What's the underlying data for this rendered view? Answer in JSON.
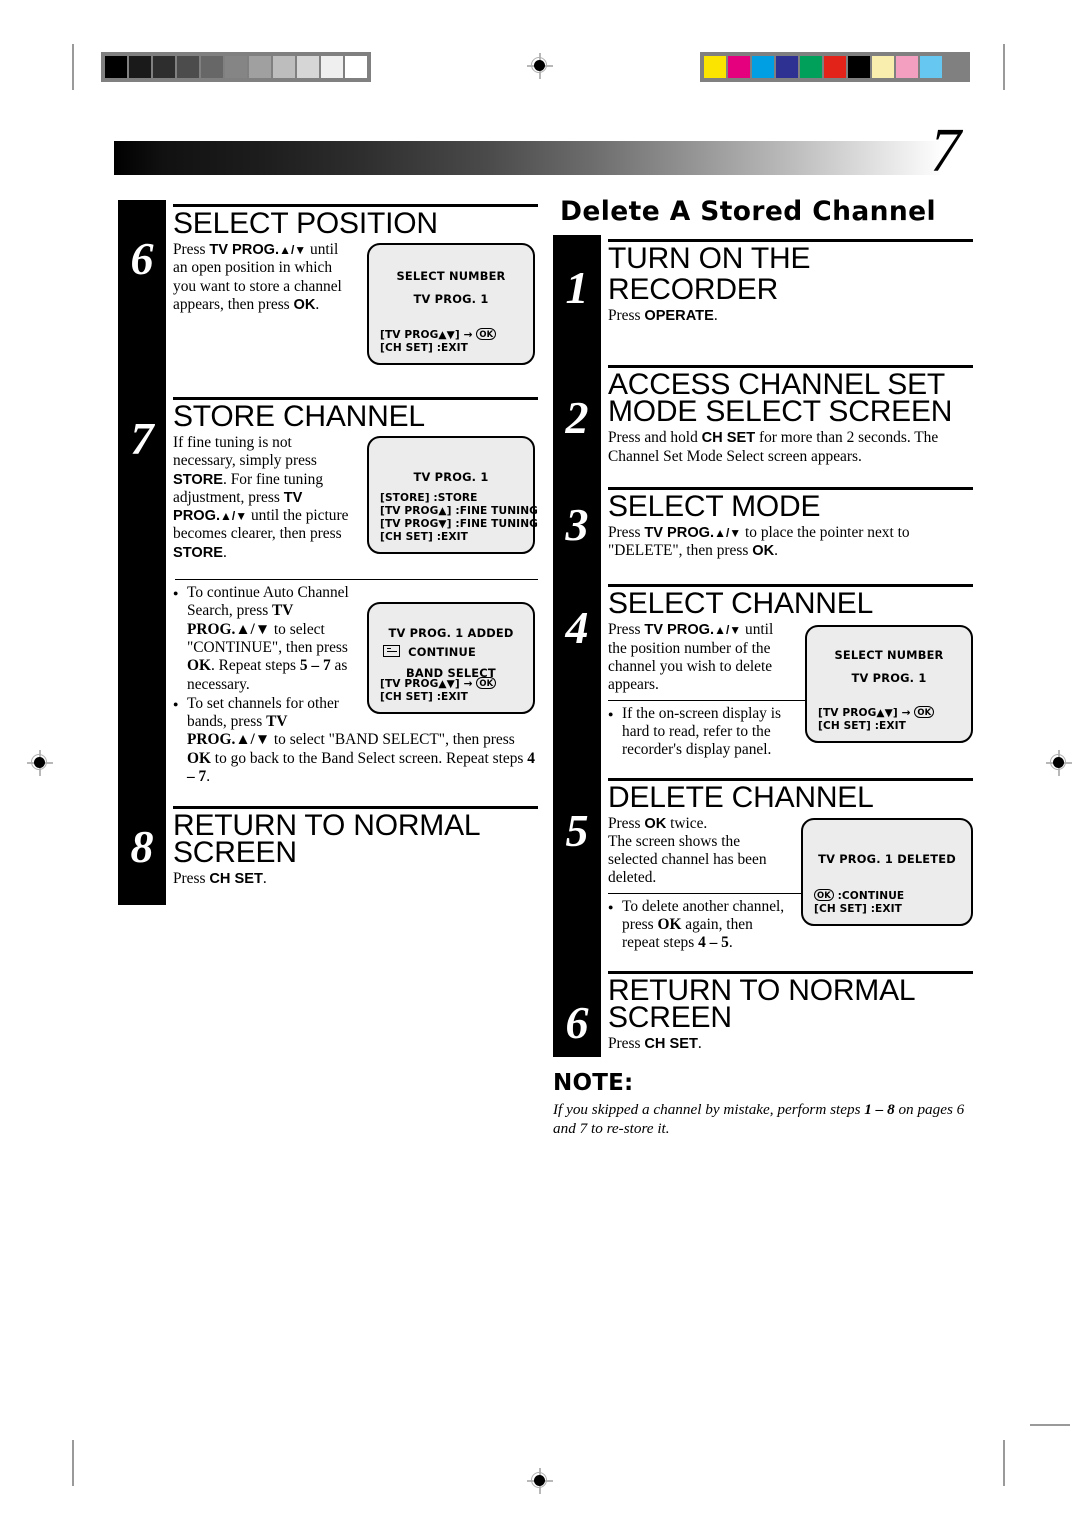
{
  "page": {
    "number": "7"
  },
  "calibration": {
    "grayscale_label": "grayscale-step-wedge",
    "grayscale_steps": [
      "#000000",
      "#1a1a1a",
      "#2e2e2e",
      "#4c4c4c",
      "#676767",
      "#858585",
      "#a0a0a0",
      "#bdbdbd",
      "#d6d6d6",
      "#efefef",
      "#ffffff"
    ],
    "color_label": "color-control-patches",
    "color_steps": [
      "#fbe400",
      "#e5007e",
      "#009fe3",
      "#2e3192",
      "#00a05a",
      "#e2231a",
      "#000000",
      "#faeeae",
      "#f39fc0",
      "#66c8f0",
      "#808080"
    ]
  },
  "left_column": {
    "steps": [
      {
        "number": "6",
        "heading": "SELECT POSITION",
        "paragraphs": [
          {
            "runs": [
              {
                "t": "Press ",
                "b": false
              },
              {
                "t": "TV PROG.",
                "b": true
              },
              {
                "t": "▲/▼",
                "b": true,
                "arrow": true
              },
              {
                "t": " until an open position in which you want to store a channel appears, then press ",
                "b": false
              },
              {
                "t": "OK",
                "b": true
              },
              {
                "t": ".",
                "b": false
              }
            ]
          }
        ],
        "osd": {
          "name": "select-number-screen",
          "title": "SELECT NUMBER",
          "lines": [
            "TV PROG.    1"
          ],
          "footer": [
            "[TV PROG▲▼] → OK",
            "[CH SET] :EXIT"
          ]
        }
      },
      {
        "number": "7",
        "heading": "STORE CHANNEL",
        "paragraphs": [
          {
            "runs": [
              {
                "t": "If fine tuning is not necessary, simply press ",
                "b": false
              },
              {
                "t": "STORE",
                "b": true
              },
              {
                "t": ". For fine tuning adjustment, press ",
                "b": false
              },
              {
                "t": "TV PROG.",
                "b": true
              },
              {
                "t": "▲/▼",
                "b": true,
                "arrow": true
              },
              {
                "t": " until the picture becomes clearer, then press ",
                "b": false
              },
              {
                "t": "STORE",
                "b": true
              },
              {
                "t": ".",
                "b": false
              }
            ]
          }
        ],
        "osd": {
          "name": "store-channel-screen",
          "title": "",
          "lines": [
            "TV PROG.    1"
          ],
          "footer": [
            "[STORE] :STORE",
            "[TV PROG▲] :FINE TUNING +",
            "[TV PROG▼] :FINE TUNING –",
            "[CH SET] :EXIT"
          ]
        }
      }
    ],
    "notes_block": {
      "bullets": [
        {
          "runs": [
            {
              "t": "To continue Auto Channel Search, press ",
              "b": false
            },
            {
              "t": "TV PROG.",
              "b": true
            },
            {
              "t": "▲/▼",
              "b": true,
              "arrow": true
            },
            {
              "t": " to select \"CONTINUE\", then press ",
              "b": false
            },
            {
              "t": "OK",
              "b": true
            },
            {
              "t": ". Repeat steps ",
              "b": false
            },
            {
              "t": "5 – 7",
              "b": true
            },
            {
              "t": " as necessary.",
              "b": false
            }
          ]
        },
        {
          "runs": [
            {
              "t": "To set channels for other bands, press ",
              "b": false
            },
            {
              "t": "TV PROG.",
              "b": true
            },
            {
              "t": "▲/▼",
              "b": true,
              "arrow": true
            },
            {
              "t": " to select \"BAND SELECT\", then press ",
              "b": false
            },
            {
              "t": "OK",
              "b": true
            },
            {
              "t": " to go back to the Band Select screen. Repeat steps ",
              "b": false
            },
            {
              "t": "4 – 7",
              "b": true
            },
            {
              "t": ".",
              "b": false
            }
          ]
        }
      ],
      "osd": {
        "name": "channel-added-screen",
        "title": "",
        "lines": [
          "TV PROG.    1   ADDED"
        ],
        "menu": [
          "CONTINUE",
          "BAND SELECT"
        ],
        "pointer_on": "CONTINUE",
        "footer": [
          "[TV PROG▲▼] → OK",
          "[CH SET] :EXIT"
        ]
      }
    },
    "final_step": {
      "number": "8",
      "heading_line1": "RETURN TO NORMAL",
      "heading_line2": "SCREEN",
      "paragraph": {
        "runs": [
          {
            "t": "Press ",
            "b": false
          },
          {
            "t": "CH SET",
            "b": true
          },
          {
            "t": ".",
            "b": false
          }
        ]
      }
    }
  },
  "right_column": {
    "section_title": "Delete A Stored Channel",
    "steps": [
      {
        "number": "1",
        "heading": "TURN ON THE RECORDER",
        "paragraphs": [
          {
            "runs": [
              {
                "t": "Press ",
                "b": false
              },
              {
                "t": "OPERATE",
                "b": true
              },
              {
                "t": ".",
                "b": false
              }
            ]
          }
        ]
      },
      {
        "number": "2",
        "heading_line1": "ACCESS CHANNEL SET",
        "heading_line2": "MODE SELECT SCREEN",
        "paragraphs": [
          {
            "runs": [
              {
                "t": "Press and hold ",
                "b": false
              },
              {
                "t": "CH SET",
                "b": true
              },
              {
                "t": " for more than 2 seconds. The Channel Set Mode Select screen appears.",
                "b": false
              }
            ]
          }
        ]
      },
      {
        "number": "3",
        "heading": "SELECT MODE",
        "paragraphs": [
          {
            "runs": [
              {
                "t": "Press ",
                "b": false
              },
              {
                "t": "TV PROG.",
                "b": true
              },
              {
                "t": "▲/▼",
                "b": true,
                "arrow": true
              },
              {
                "t": " to place the pointer next to \"DELETE\", then press ",
                "b": false
              },
              {
                "t": "OK",
                "b": true
              },
              {
                "t": ".",
                "b": false
              }
            ]
          }
        ]
      },
      {
        "number": "4",
        "heading": "SELECT CHANNEL",
        "paragraphs": [
          {
            "runs": [
              {
                "t": "Press ",
                "b": false
              },
              {
                "t": "TV PROG.",
                "b": true
              },
              {
                "t": "▲/▼",
                "b": true,
                "arrow": true
              },
              {
                "t": " until the position number of the channel you wish to delete appears.",
                "b": false
              }
            ]
          }
        ],
        "bullets": [
          {
            "runs": [
              {
                "t": "If the on-screen display is hard to read, refer to the recorder's display panel.",
                "b": false
              }
            ]
          }
        ],
        "osd": {
          "name": "select-number-screen-delete",
          "title": "SELECT NUMBER",
          "lines": [
            "TV PROG.    1"
          ],
          "footer": [
            "[TV PROG▲▼] → OK",
            "[CH SET] :EXIT"
          ]
        }
      },
      {
        "number": "5",
        "heading": "DELETE CHANNEL",
        "paragraphs": [
          {
            "runs": [
              {
                "t": "Press ",
                "b": false
              },
              {
                "t": "OK",
                "b": true
              },
              {
                "t": " twice.",
                "b": false
              }
            ]
          },
          {
            "runs": [
              {
                "t": "The screen shows the selected channel has been deleted.",
                "b": false
              }
            ]
          }
        ],
        "bullets": [
          {
            "runs": [
              {
                "t": "To delete another channel, press ",
                "b": false
              },
              {
                "t": "OK",
                "b": true
              },
              {
                "t": " again, then repeat steps ",
                "b": false
              },
              {
                "t": "4 – 5",
                "b": true
              },
              {
                "t": ".",
                "b": false
              }
            ]
          }
        ],
        "osd": {
          "name": "channel-deleted-screen",
          "title": "",
          "lines": [
            "TV PROG.    1  DELETED"
          ],
          "footer": [
            "OK :CONTINUE",
            "[CH SET] :EXIT"
          ]
        }
      },
      {
        "number": "6",
        "heading_line1": "RETURN TO NORMAL",
        "heading_line2": "SCREEN",
        "paragraphs": [
          {
            "runs": [
              {
                "t": "Press ",
                "b": false
              },
              {
                "t": "CH SET",
                "b": true
              },
              {
                "t": ".",
                "b": false
              }
            ]
          }
        ]
      }
    ],
    "note": {
      "title": "NOTE:",
      "runs": [
        {
          "t": "If you skipped a channel by mistake, perform steps ",
          "b": false
        },
        {
          "t": "1 – 8",
          "b": true
        },
        {
          "t": " on pages 6 and 7 to re-store it.",
          "b": false
        }
      ]
    }
  }
}
